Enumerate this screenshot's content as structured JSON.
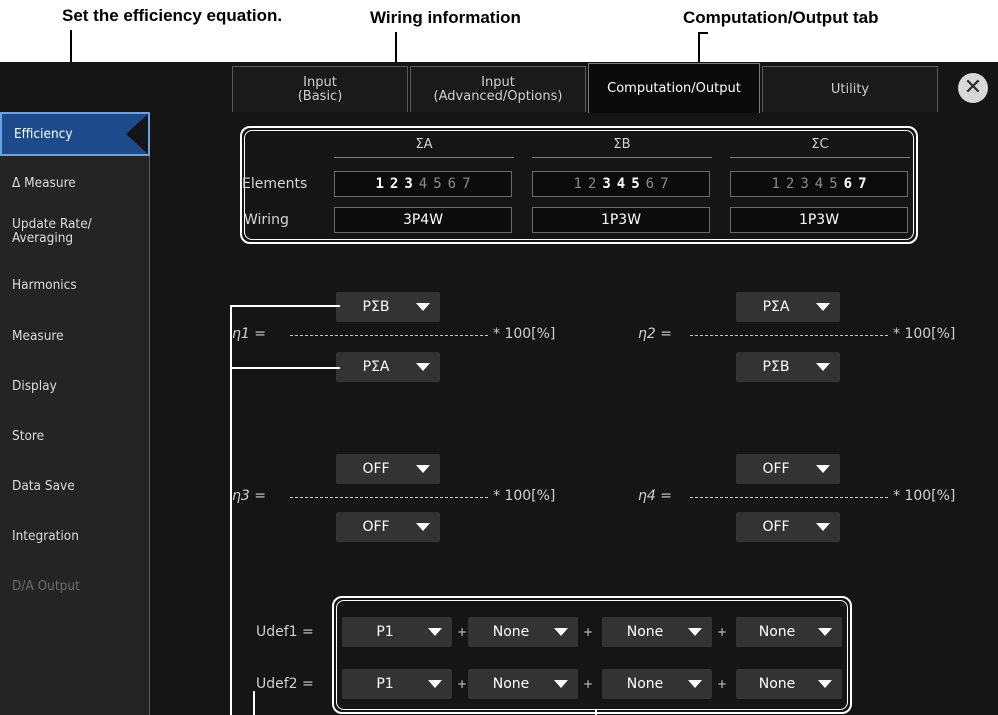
{
  "callouts": {
    "efficiency_equation": "Set the efficiency equation.",
    "wiring_info": "Wiring information",
    "tab": "Computation/Output tab"
  },
  "tabs": [
    {
      "label": "Input\n(Basic)"
    },
    {
      "label": "Input\n(Advanced/Options)"
    },
    {
      "label": "Computation/Output"
    },
    {
      "label": "Utility"
    }
  ],
  "close_symbol": "✕",
  "sidebar": {
    "items": [
      {
        "label": "Efficiency"
      },
      {
        "label": "Δ Measure"
      },
      {
        "label": "Update Rate/\nAveraging"
      },
      {
        "label": "Harmonics"
      },
      {
        "label": "Measure"
      },
      {
        "label": "Display"
      },
      {
        "label": "Store"
      },
      {
        "label": "Data Save"
      },
      {
        "label": "Integration"
      },
      {
        "label": "D/A Output"
      }
    ]
  },
  "wiring": {
    "row_elements_label": "Elements",
    "row_wiring_label": "Wiring",
    "groups": [
      {
        "name": "ΣA",
        "elements": [
          "1",
          "2",
          "3",
          "4",
          "5",
          "6",
          "7"
        ],
        "active": [
          true,
          true,
          true,
          false,
          false,
          false,
          false
        ],
        "wiring": "3P4W"
      },
      {
        "name": "ΣB",
        "elements": [
          "1",
          "2",
          "3",
          "4",
          "5",
          "6",
          "7"
        ],
        "active": [
          false,
          false,
          true,
          true,
          true,
          false,
          false
        ],
        "wiring": "1P3W"
      },
      {
        "name": "ΣC",
        "elements": [
          "1",
          "2",
          "3",
          "4",
          "5",
          "6",
          "7"
        ],
        "active": [
          false,
          false,
          false,
          false,
          false,
          true,
          true
        ],
        "wiring": "1P3W"
      }
    ]
  },
  "efficiency": {
    "multiplier": "* 100[%]",
    "equations": [
      {
        "label": "η1 =",
        "numerator": "PΣB",
        "denominator": "PΣA"
      },
      {
        "label": "η2 =",
        "numerator": "PΣA",
        "denominator": "PΣB"
      },
      {
        "label": "η3 =",
        "numerator": "OFF",
        "denominator": "OFF"
      },
      {
        "label": "η4 =",
        "numerator": "OFF",
        "denominator": "OFF"
      }
    ]
  },
  "udef": {
    "plus": "+",
    "rows": [
      {
        "label": "Udef1 =",
        "terms": [
          "P1",
          "None",
          "None",
          "None"
        ]
      },
      {
        "label": "Udef2 =",
        "terms": [
          "P1",
          "None",
          "None",
          "None"
        ]
      }
    ]
  },
  "colors": {
    "background": "#151515",
    "sidebar_active": "#1d4a8a",
    "dropdown": "#333333"
  }
}
